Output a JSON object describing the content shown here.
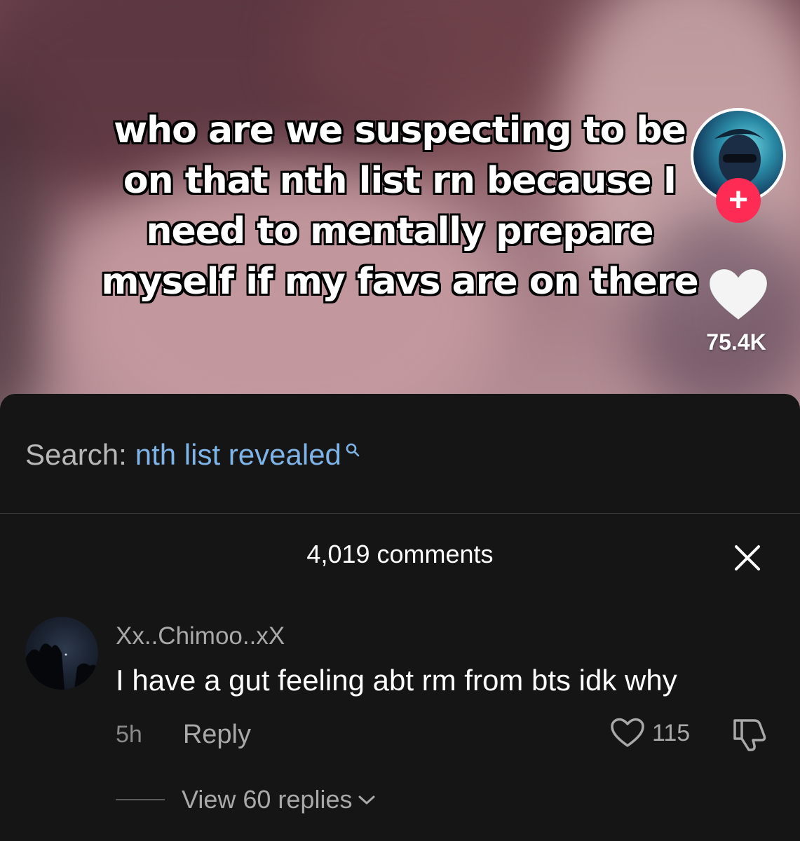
{
  "video": {
    "caption_lines": [
      "who are we suspecting to be",
      "on that nth list rn because I",
      "need to mentally prepare",
      "myself if my favs are on there"
    ],
    "like_count": "75.4K",
    "follow_symbol": "+"
  },
  "search": {
    "prefix": "Search:",
    "term": "nth list revealed"
  },
  "comments_panel": {
    "title": "4,019 comments",
    "close_symbol": "×"
  },
  "comment": {
    "username": "Xx..Chimoo..xX",
    "text": "I have a gut feeling abt rm from bts idk why",
    "timestamp": "5h",
    "reply_label": "Reply",
    "like_count": "115",
    "view_replies_label": "View 60 replies"
  },
  "colors": {
    "accent_red": "#fe2c55",
    "search_link": "#7fb4e8",
    "sheet_bg": "#151515"
  }
}
